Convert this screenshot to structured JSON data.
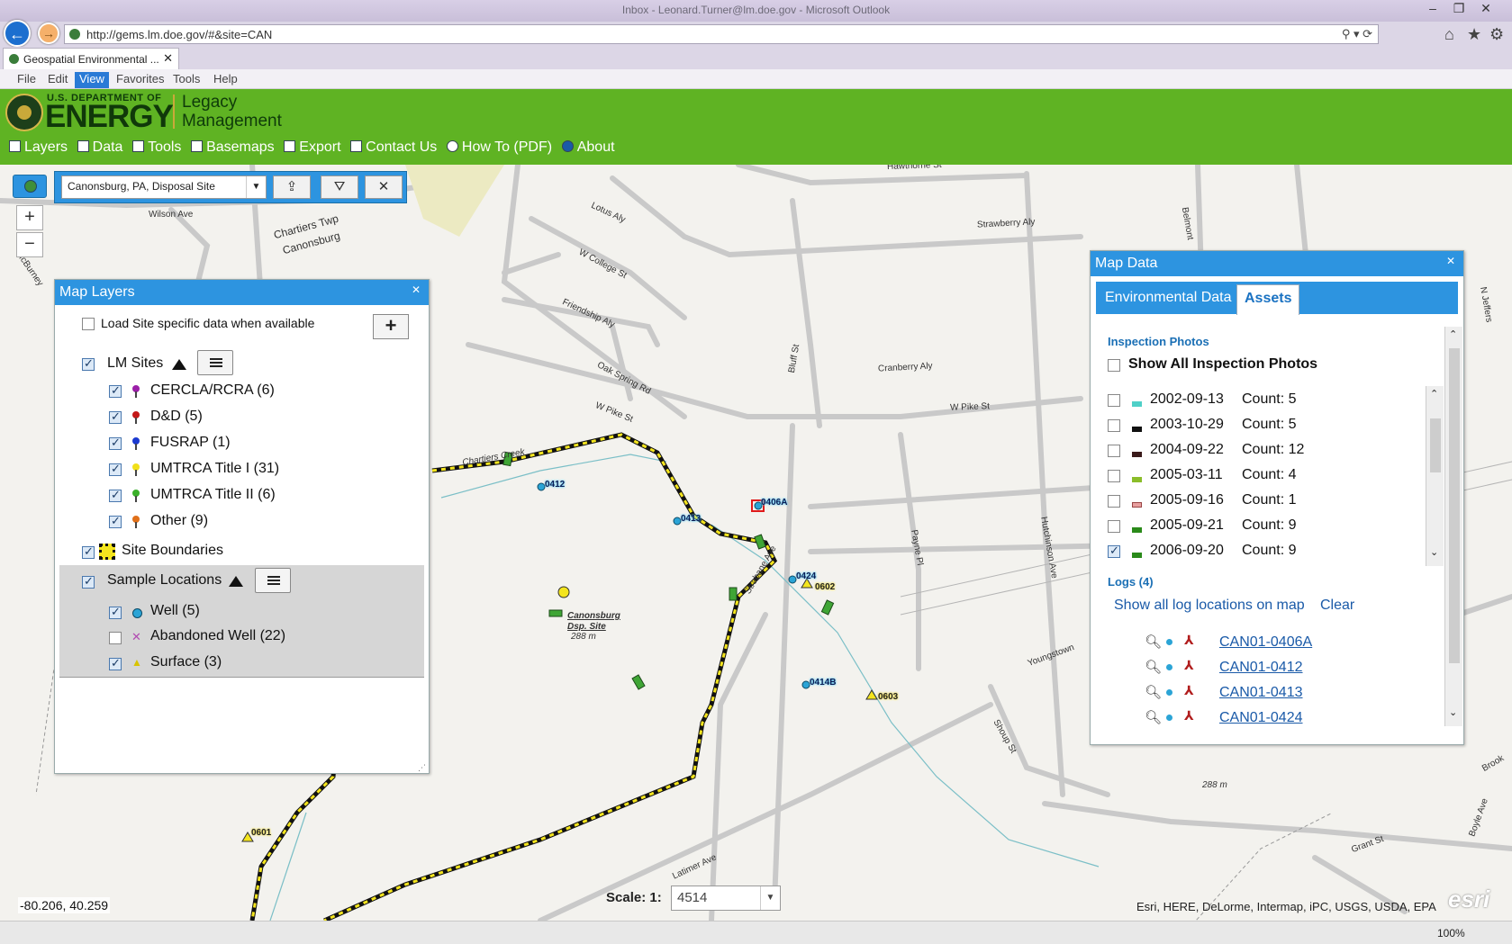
{
  "browser": {
    "window_title": "Inbox - Leonard.Turner@lm.doe.gov - Microsoft Outlook",
    "url": "http://gems.lm.doe.gov/#&site=CAN",
    "tab_title": "Geospatial Environmental ...",
    "menu": [
      "File",
      "Edit",
      "View",
      "Favorites",
      "Tools",
      "Help"
    ],
    "zoom": "100%"
  },
  "app": {
    "logo_top": "U.S. DEPARTMENT OF",
    "logo_main": "ENERGY",
    "logo_sub1": "Legacy",
    "logo_sub2": "Management",
    "nav": [
      {
        "label": "Layers",
        "icon": "layers-icon"
      },
      {
        "label": "Data",
        "icon": "table-icon"
      },
      {
        "label": "Tools",
        "icon": "tools-icon"
      },
      {
        "label": "Basemaps",
        "icon": "basemaps-icon"
      },
      {
        "label": "Export",
        "icon": "printer-icon"
      },
      {
        "label": "Contact Us",
        "icon": "envelope-icon"
      },
      {
        "label": "How To (PDF)",
        "icon": "help-icon"
      },
      {
        "label": "About",
        "icon": "info-icon"
      }
    ]
  },
  "site_selector": {
    "value": "Canonsburg, PA, Disposal Site"
  },
  "map_layers": {
    "title": "Map Layers",
    "load_site_label": "Load Site specific data when available",
    "lm_sites": {
      "label": "LM Sites",
      "items": [
        {
          "label": "CERCLA/RCRA (6)",
          "color": "#9b1fa8"
        },
        {
          "label": "D&D (5)",
          "color": "#c41818"
        },
        {
          "label": "FUSRAP (1)",
          "color": "#1c3ad0"
        },
        {
          "label": "UMTRCA Title I (31)",
          "color": "#f1e01a"
        },
        {
          "label": "UMTRCA Title II (6)",
          "color": "#3ab02a"
        },
        {
          "label": "Other (9)",
          "color": "#e0701a"
        }
      ]
    },
    "site_boundaries": "Site Boundaries",
    "sample_locations": {
      "label": "Sample Locations",
      "items": [
        {
          "label": "Well (5)",
          "checked": true
        },
        {
          "label": "Abandoned Well (22)",
          "checked": false
        },
        {
          "label": "Surface (3)",
          "checked": true
        }
      ]
    }
  },
  "map_data": {
    "title": "Map Data",
    "tabs": [
      "Environmental Data",
      "Assets"
    ],
    "inspection_heading": "Inspection Photos",
    "show_all_label": "Show All Inspection Photos",
    "photos": [
      {
        "date": "2002-09-13",
        "count": "Count: 5",
        "checked": false,
        "color": "#4fd0c8"
      },
      {
        "date": "2003-10-29",
        "count": "Count: 5",
        "checked": false,
        "color": "#111111"
      },
      {
        "date": "2004-09-22",
        "count": "Count: 12",
        "checked": false,
        "color": "#3a1a1a"
      },
      {
        "date": "2005-03-11",
        "count": "Count: 4",
        "checked": false,
        "color": "#8bbd2a"
      },
      {
        "date": "2005-09-16",
        "count": "Count: 1",
        "checked": false,
        "color": "#e8a0a0"
      },
      {
        "date": "2005-09-21",
        "count": "Count: 9",
        "checked": false,
        "color": "#2a8a1a"
      },
      {
        "date": "2006-09-20",
        "count": "Count: 9",
        "checked": true,
        "color": "#2a8a1a"
      }
    ],
    "logs_heading": "Logs (4)",
    "show_all_logs": "Show all log locations on map",
    "clear": "Clear",
    "logs": [
      "CAN01-0406A",
      "CAN01-0412",
      "CAN01-0413",
      "CAN01-0424"
    ]
  },
  "map": {
    "streets": [
      "Hawthorne St",
      "Lotus Aly",
      "Wilson Ave",
      "Chartiers Twp",
      "Canonsburg",
      "Strawberry Aly",
      "W College St",
      "Friendship Aly",
      "Oak Spring Rd",
      "Cranberry Aly",
      "W Pike St",
      "W Pike St",
      "Bluff St",
      "Payne Pl",
      "Hutchinson Ave",
      "Strabane Ave",
      "Youngstown",
      "Shoup St",
      "Grant St",
      "Boyle Ave",
      "Latimer Ave",
      "McBurney",
      "Belmont",
      "N Jeffers",
      "Chartiers Creek",
      "Brook"
    ],
    "site_label_1": "Canonsburg",
    "site_label_2": "Dsp. Site",
    "elev_1": "288 m",
    "elev_2": "288 m",
    "points_well": [
      "0412",
      "0413",
      "0406A",
      "0424",
      "0414B"
    ],
    "points_surface": [
      "0602",
      "0603",
      "0601"
    ],
    "coords": "-80.206, 40.259",
    "scale_label": "Scale: 1:",
    "scale_value": "4514",
    "attribution": "Esri, HERE, DeLorme, Intermap, iPC, USGS, USDA, EPA",
    "esri": "esri"
  }
}
